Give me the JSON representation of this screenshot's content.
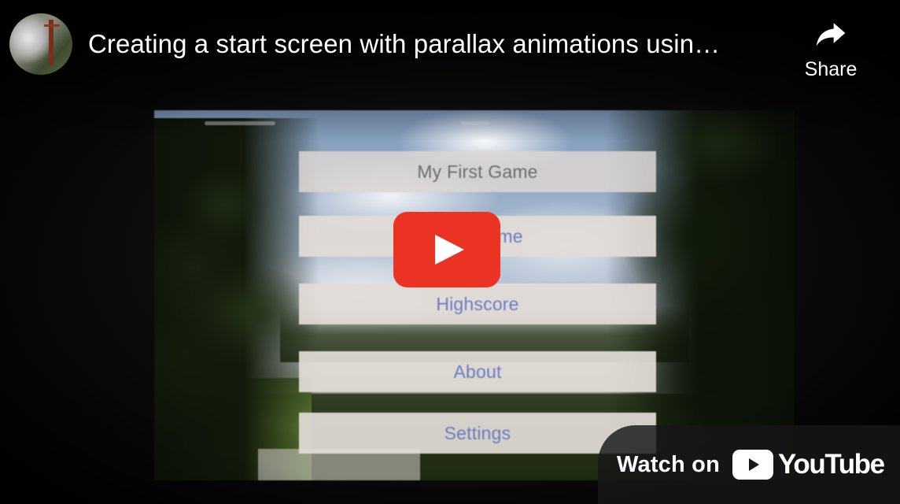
{
  "header": {
    "title": "Creating a start screen with parallax animations usin…",
    "channel_avatar_icon": "channel-avatar",
    "share_label": "Share",
    "share_icon": "share-arrow-icon"
  },
  "video_frame": {
    "menu": {
      "title": "My First Game",
      "items": [
        "Play Game",
        "Highscore",
        "About",
        "Settings"
      ]
    },
    "menu_text_color": "#6a7ec4"
  },
  "player": {
    "play_button_icon": "play-icon",
    "play_button_color": "#ea3323"
  },
  "watch_on": {
    "label": "Watch on",
    "logo_text": "YouTube",
    "logo_icon": "youtube-logo-icon"
  }
}
